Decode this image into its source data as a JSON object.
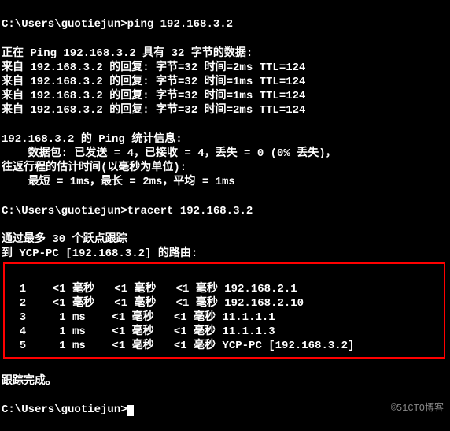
{
  "prompt_path": "C:\\Users\\guotiejun>",
  "ping_cmd": "ping 192.168.3.2",
  "ping_header": "正在 Ping 192.168.3.2 具有 32 字节的数据:",
  "replies": [
    "来自 192.168.3.2 的回复: 字节=32 时间=2ms TTL=124",
    "来自 192.168.3.2 的回复: 字节=32 时间=1ms TTL=124",
    "来自 192.168.3.2 的回复: 字节=32 时间=1ms TTL=124",
    "来自 192.168.3.2 的回复: 字节=32 时间=2ms TTL=124"
  ],
  "stats_header": "192.168.3.2 的 Ping 统计信息:",
  "stats_packets": "    数据包: 已发送 = 4，已接收 = 4，丢失 = 0 (0% 丢失)，",
  "stats_rtt_header": "往返行程的估计时间(以毫秒为单位):",
  "stats_rtt": "    最短 = 1ms，最长 = 2ms，平均 = 1ms",
  "tracert_cmd": "tracert 192.168.3.2",
  "tracert_header1": "通过最多 30 个跃点跟踪",
  "tracert_header2": "到 YCP-PC [192.168.3.2] 的路由:",
  "hops": [
    "  1    <1 毫秒   <1 毫秒   <1 毫秒 192.168.2.1",
    "  2    <1 毫秒   <1 毫秒   <1 毫秒 192.168.2.10",
    "  3     1 ms    <1 毫秒   <1 毫秒 11.1.1.1",
    "  4     1 ms    <1 毫秒   <1 毫秒 11.1.1.3",
    "  5     1 ms    <1 毫秒   <1 毫秒 YCP-PC [192.168.3.2]"
  ],
  "tracert_done": "跟踪完成。",
  "watermark": "©51CTO博客"
}
